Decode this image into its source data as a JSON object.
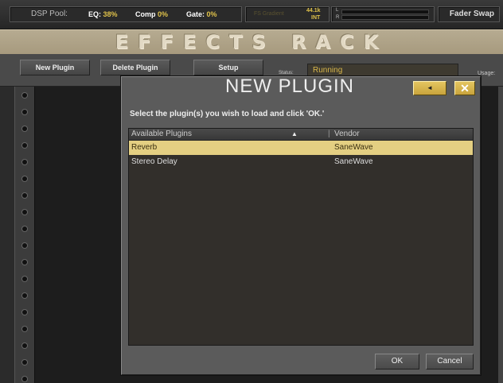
{
  "topbar": {
    "dsp_label": "DSP Pool:",
    "eq_label": "EQ:",
    "eq_value": "38%",
    "comp_label": "Comp",
    "comp_value": "0%",
    "gate_label": "Gate:",
    "gate_value": "0%",
    "fs_text": "FS Gradient",
    "sample_rate": "44.1k",
    "clock_source": "INT",
    "meter_left": "L",
    "meter_right": "R",
    "fader_swap": "Fader Swap"
  },
  "title": "EFFECTS RACK",
  "toolbar": {
    "new_plugin": "New Plugin",
    "delete_plugin": "Delete Plugin",
    "setup": "Setup",
    "status_label": "Status:",
    "status_value": "Running",
    "usage_label": "Usage:"
  },
  "dialog": {
    "title": "NEW PLUGIN",
    "back_icon": "◄",
    "close_icon": "✕",
    "instruction": "Select the plugin(s) you wish to load and click 'OK.'",
    "columns": {
      "name": "Available Plugins",
      "sort_icon": "▲",
      "vendor": "Vendor"
    },
    "plugins": [
      {
        "name": "Reverb",
        "vendor": "SaneWave",
        "selected": true
      },
      {
        "name": "Stereo Delay",
        "vendor": "SaneWave",
        "selected": false
      }
    ],
    "ok": "OK",
    "cancel": "Cancel"
  },
  "colors": {
    "accent_yellow": "#e0c24a",
    "selected_row": "#e4cf82",
    "title_bar": "#b0a488"
  }
}
